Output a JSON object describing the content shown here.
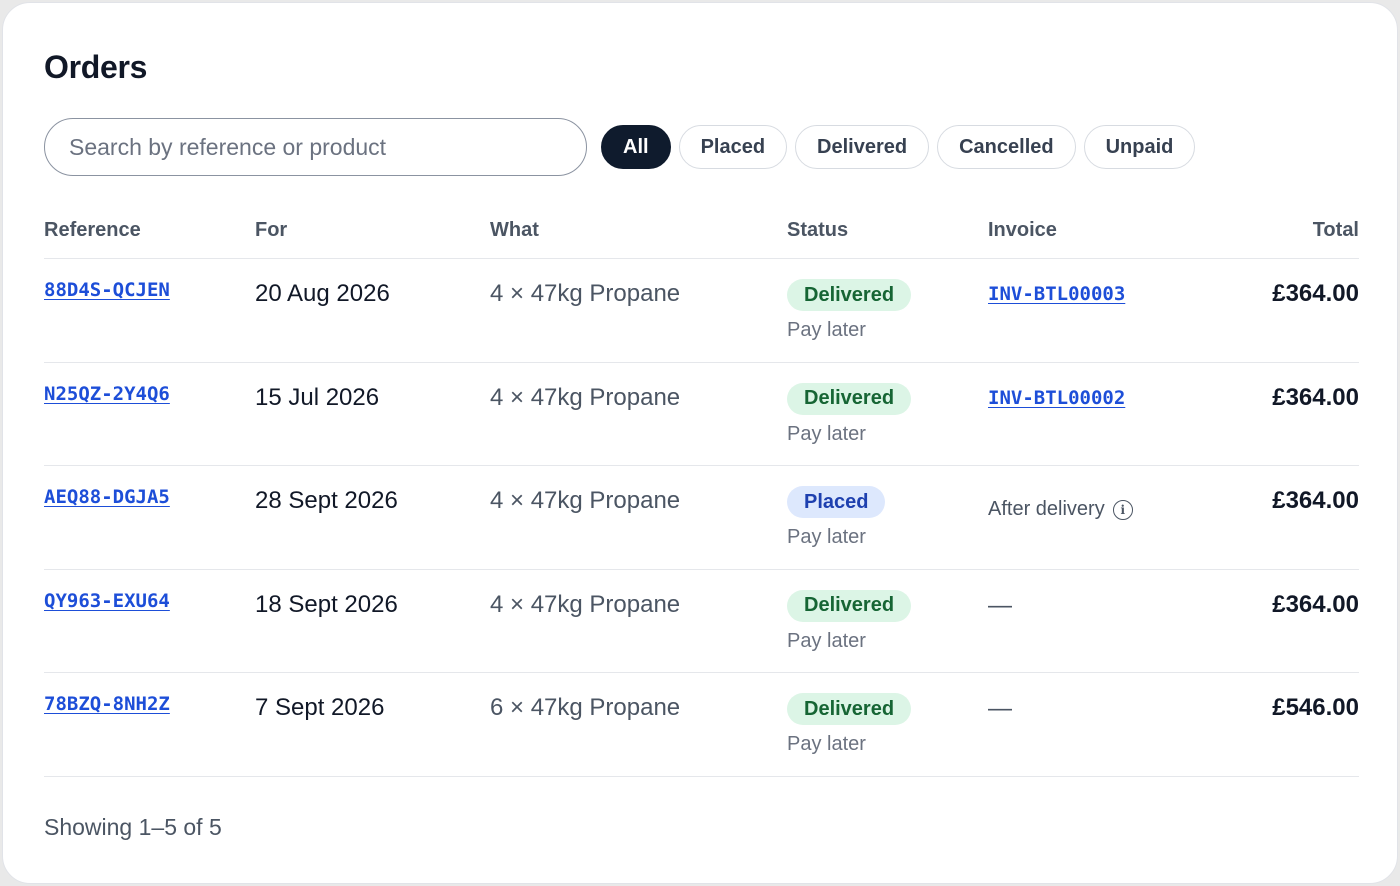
{
  "page": {
    "title": "Orders"
  },
  "search": {
    "placeholder": "Search by reference or product",
    "value": ""
  },
  "filters": [
    {
      "label": "All",
      "active": true
    },
    {
      "label": "Placed",
      "active": false
    },
    {
      "label": "Delivered",
      "active": false
    },
    {
      "label": "Cancelled",
      "active": false
    },
    {
      "label": "Unpaid",
      "active": false
    }
  ],
  "table": {
    "headers": {
      "reference": "Reference",
      "for": "For",
      "what": "What",
      "status": "Status",
      "invoice": "Invoice",
      "total": "Total"
    },
    "rows": [
      {
        "reference": "88D4S-QCJEN",
        "for": "20 Aug 2026",
        "what": "4 × 47kg Propane",
        "status": "Delivered",
        "status_kind": "delivered",
        "payment": "Pay later",
        "invoice": "INV-BTL00003",
        "invoice_kind": "link",
        "total": "£364.00"
      },
      {
        "reference": "N25QZ-2Y4Q6",
        "for": "15 Jul 2026",
        "what": "4 × 47kg Propane",
        "status": "Delivered",
        "status_kind": "delivered",
        "payment": "Pay later",
        "invoice": "INV-BTL00002",
        "invoice_kind": "link",
        "total": "£364.00"
      },
      {
        "reference": "AEQ88-DGJA5",
        "for": "28 Sept 2026",
        "what": "4 × 47kg Propane",
        "status": "Placed",
        "status_kind": "placed",
        "payment": "Pay later",
        "invoice": "After delivery",
        "invoice_kind": "text",
        "total": "£364.00"
      },
      {
        "reference": "QY963-EXU64",
        "for": "18 Sept 2026",
        "what": "4 × 47kg Propane",
        "status": "Delivered",
        "status_kind": "delivered",
        "payment": "Pay later",
        "invoice": "—",
        "invoice_kind": "dash",
        "total": "£364.00"
      },
      {
        "reference": "78BZQ-8NH2Z",
        "for": "7 Sept 2026",
        "what": "6 × 47kg Propane",
        "status": "Delivered",
        "status_kind": "delivered",
        "payment": "Pay later",
        "invoice": "—",
        "invoice_kind": "dash",
        "total": "£546.00"
      }
    ]
  },
  "footer": {
    "text": "Showing 1–5 of 5"
  },
  "icons": {
    "info": "info-icon"
  },
  "colors": {
    "accent": "#1d4ed8",
    "chip_active_bg": "#0f1b2d",
    "delivered_bg": "#dcf5e6",
    "delivered_text": "#166534",
    "placed_bg": "#dde8fd",
    "placed_text": "#1e40af"
  }
}
